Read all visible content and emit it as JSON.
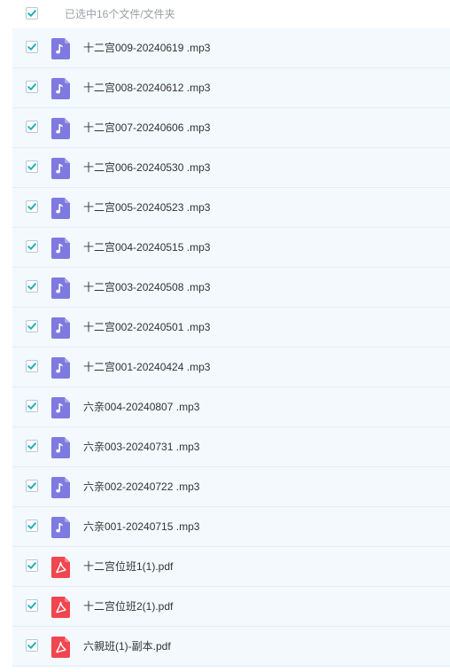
{
  "colors": {
    "check": "#1fb0b8",
    "audio_icon": "#7e7ae0",
    "pdf_icon": "#f0464f"
  },
  "header": {
    "select_all_checked": true,
    "selection_label": "已选中16个文件/文件夹"
  },
  "files": [
    {
      "name": "十二宫009-20240619 .mp3",
      "type": "audio",
      "icon": "music-note-icon",
      "checked": true
    },
    {
      "name": "十二宫008-20240612 .mp3",
      "type": "audio",
      "icon": "music-note-icon",
      "checked": true
    },
    {
      "name": "十二宫007-20240606 .mp3",
      "type": "audio",
      "icon": "music-note-icon",
      "checked": true
    },
    {
      "name": "十二宫006-20240530 .mp3",
      "type": "audio",
      "icon": "music-note-icon",
      "checked": true
    },
    {
      "name": "十二宫005-20240523 .mp3",
      "type": "audio",
      "icon": "music-note-icon",
      "checked": true
    },
    {
      "name": "十二宫004-20240515 .mp3",
      "type": "audio",
      "icon": "music-note-icon",
      "checked": true
    },
    {
      "name": "十二宫003-20240508 .mp3",
      "type": "audio",
      "icon": "music-note-icon",
      "checked": true
    },
    {
      "name": "十二宫002-20240501 .mp3",
      "type": "audio",
      "icon": "music-note-icon",
      "checked": true
    },
    {
      "name": "十二宫001-20240424 .mp3",
      "type": "audio",
      "icon": "music-note-icon",
      "checked": true
    },
    {
      "name": "六亲004-20240807 .mp3",
      "type": "audio",
      "icon": "music-note-icon",
      "checked": true
    },
    {
      "name": "六亲003-20240731 .mp3",
      "type": "audio",
      "icon": "music-note-icon",
      "checked": true
    },
    {
      "name": "六亲002-20240722 .mp3",
      "type": "audio",
      "icon": "music-note-icon",
      "checked": true
    },
    {
      "name": "六亲001-20240715 .mp3",
      "type": "audio",
      "icon": "music-note-icon",
      "checked": true
    },
    {
      "name": "十二宫位班1(1).pdf",
      "type": "pdf",
      "icon": "pdf-file-icon",
      "checked": true
    },
    {
      "name": "十二宫位班2(1).pdf",
      "type": "pdf",
      "icon": "pdf-file-icon",
      "checked": true
    },
    {
      "name": "六親班(1)-副本.pdf",
      "type": "pdf",
      "icon": "pdf-file-icon",
      "checked": true
    }
  ]
}
